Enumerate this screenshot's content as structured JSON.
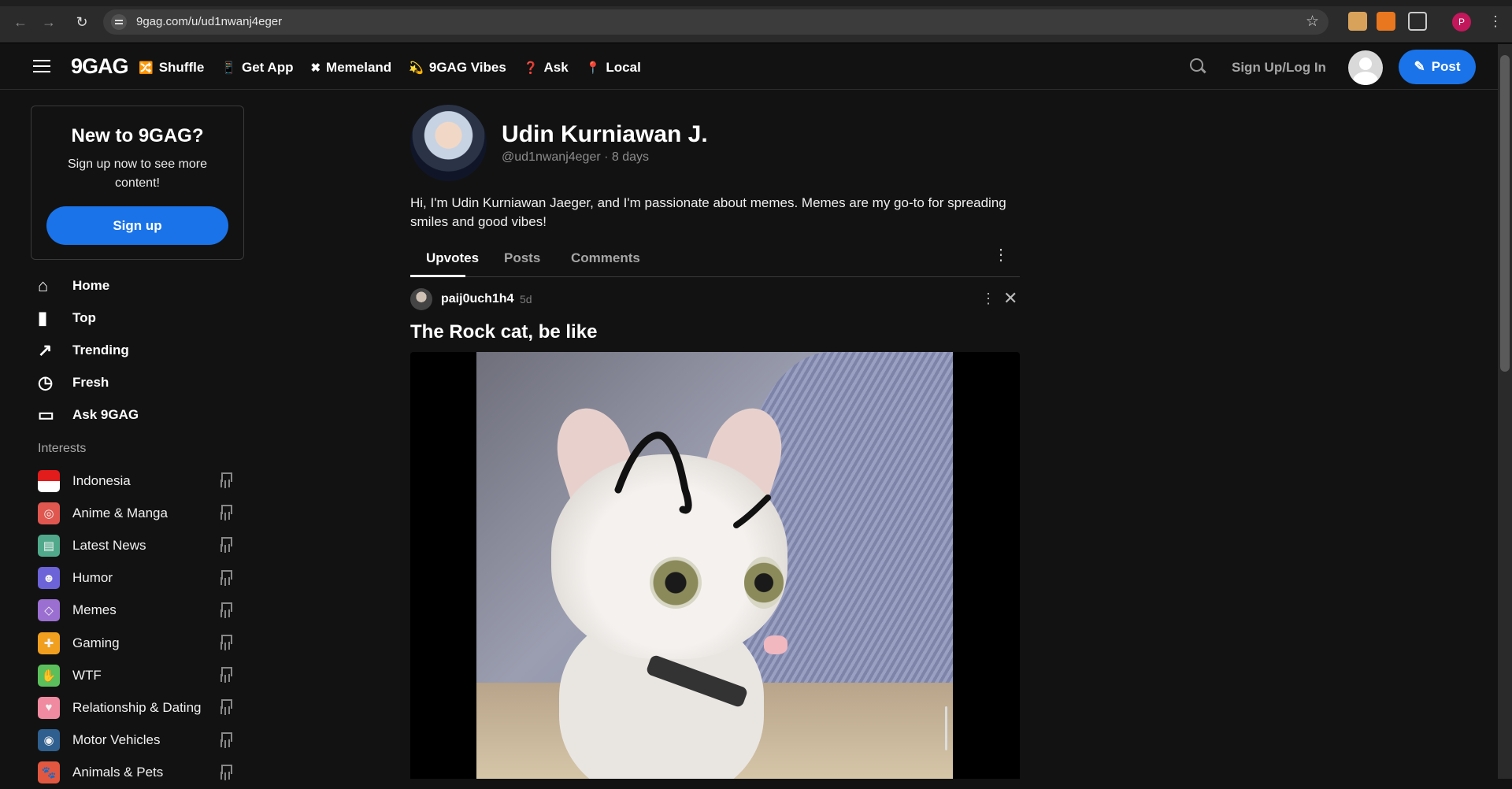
{
  "browser": {
    "url": "9gag.com/u/ud1nwanj4eger",
    "profile_initial": "P"
  },
  "header": {
    "logo": "9GAG",
    "nav": [
      {
        "icon": "shuffle-icon",
        "glyph": "🔀",
        "label": "Shuffle"
      },
      {
        "icon": "phone-icon",
        "glyph": "📱",
        "label": "Get App"
      },
      {
        "icon": "memeland-icon",
        "glyph": "✖",
        "label": "Memeland"
      },
      {
        "icon": "vibes-icon",
        "glyph": "💫",
        "label": "9GAG Vibes"
      },
      {
        "icon": "question-icon",
        "glyph": "❓",
        "label": "Ask"
      },
      {
        "icon": "pin-location-icon",
        "glyph": "📍",
        "label": "Local"
      }
    ],
    "signup_login": "Sign Up/Log In",
    "post_button": "Post"
  },
  "signup_card": {
    "title": "New to 9GAG?",
    "text": "Sign up now to see more content!",
    "button": "Sign up"
  },
  "sidebar": {
    "nav": [
      {
        "label": "Home",
        "glyph": "⌂"
      },
      {
        "label": "Top",
        "glyph": "▮"
      },
      {
        "label": "Trending",
        "glyph": "↗"
      },
      {
        "label": "Fresh",
        "glyph": "◷"
      },
      {
        "label": "Ask 9GAG",
        "glyph": "▭"
      }
    ],
    "interests_heading": "Interests",
    "interests": [
      {
        "label": "Indonesia",
        "color": "#ffffff",
        "glyph": ""
      },
      {
        "label": "Anime & Manga",
        "color": "#e0574f",
        "glyph": "◎"
      },
      {
        "label": "Latest News",
        "color": "#4fa98a",
        "glyph": "▤"
      },
      {
        "label": "Humor",
        "color": "#6c63d8",
        "glyph": "☻"
      },
      {
        "label": "Memes",
        "color": "#9b6fd1",
        "glyph": "◇"
      },
      {
        "label": "Gaming",
        "color": "#f0a01e",
        "glyph": "✚"
      },
      {
        "label": "WTF",
        "color": "#5bc05b",
        "glyph": "✋"
      },
      {
        "label": "Relationship & Dating",
        "color": "#f08aa0",
        "glyph": "♥"
      },
      {
        "label": "Motor Vehicles",
        "color": "#2f5f8f",
        "glyph": "◉"
      },
      {
        "label": "Animals & Pets",
        "color": "#e2573f",
        "glyph": "🐾"
      }
    ]
  },
  "profile": {
    "name": "Udin Kurniawan J.",
    "handle_meta": "@ud1nwanj4eger · 8 days",
    "bio": "Hi, I'm Udin Kurniawan Jaeger, and I'm passionate about memes. Memes are my go-to for spreading smiles and good vibes!",
    "tabs": [
      "Upvotes",
      "Posts",
      "Comments"
    ],
    "active_tab": "Upvotes"
  },
  "post": {
    "user": "paij0uch1h4",
    "time": "5d",
    "title": "The Rock cat, be like"
  }
}
